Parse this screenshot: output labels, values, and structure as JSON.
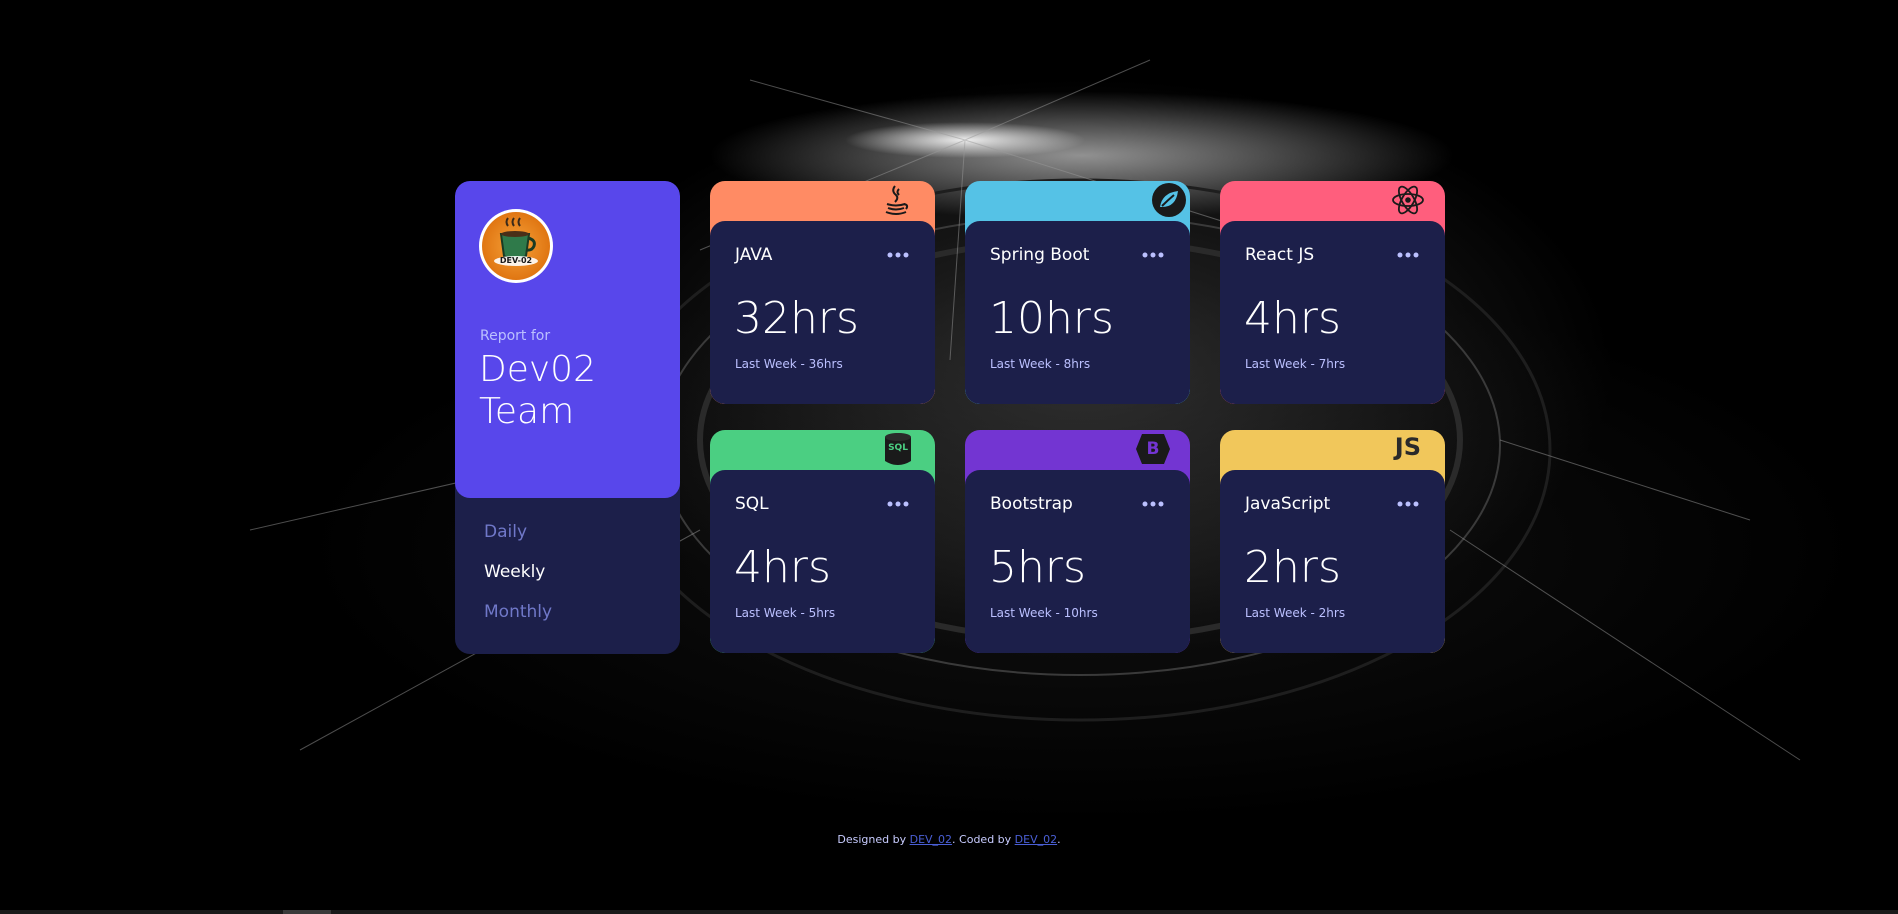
{
  "profile": {
    "report_for": "Report for",
    "name": "Dev02 Team",
    "avatar_icon": "coffee-cup-logo",
    "avatar_text": "DEV-02"
  },
  "periods": [
    {
      "label": "Daily",
      "active": false
    },
    {
      "label": "Weekly",
      "active": true
    },
    {
      "label": "Monthly",
      "active": false
    }
  ],
  "activities": [
    {
      "title": "JAVA",
      "current": "32hrs",
      "previous": "Last Week - 36hrs",
      "color": "#ff8b64",
      "icon": "java-icon"
    },
    {
      "title": "Spring Boot",
      "current": "10hrs",
      "previous": "Last Week - 8hrs",
      "color": "#55c2e6",
      "icon": "spring-icon"
    },
    {
      "title": "React JS",
      "current": "4hrs",
      "previous": "Last Week - 7hrs",
      "color": "#ff5e7d",
      "icon": "react-icon"
    },
    {
      "title": "SQL",
      "current": "4hrs",
      "previous": "Last Week - 5hrs",
      "color": "#4bcf82",
      "icon": "sql-icon",
      "icon_text": "SQL"
    },
    {
      "title": "Bootstrap",
      "current": "5hrs",
      "previous": "Last Week - 10hrs",
      "color": "#7335d2",
      "icon": "bootstrap-icon",
      "icon_text": "B"
    },
    {
      "title": "JavaScript",
      "current": "2hrs",
      "previous": "Last Week - 2hrs",
      "color": "#f1c75b",
      "icon": "javascript-icon",
      "icon_text": "JS"
    }
  ],
  "footer": {
    "designed_by": "Designed by",
    "designer": "DEV_02",
    "coded_by": ". Coded by",
    "coder": "DEV_02",
    "end": "."
  },
  "colors": {
    "card_bg": "#1c1f4a",
    "profile_bg": "#5847eb",
    "muted_text": "#7078c9",
    "pale_text": "#bbc0ff"
  }
}
